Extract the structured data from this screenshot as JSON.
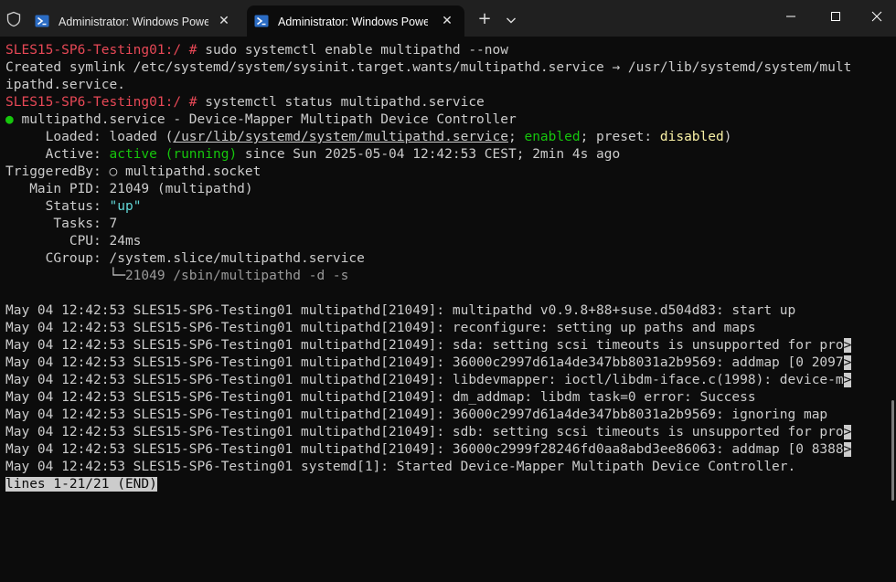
{
  "window": {
    "tabs": [
      {
        "title": "Administrator: Windows PowerShell",
        "close": "✕",
        "icon": "powershell-icon"
      },
      {
        "title": "Administrator: Windows PowerShell",
        "close": "✕",
        "icon": "powershell-icon"
      }
    ],
    "new_tab": "+",
    "controls": {
      "minimize": "minimize-icon",
      "maximize": "maximize-icon",
      "close": "close-icon"
    }
  },
  "colors": {
    "background": "#0c0c0c",
    "prompt": "#e74856",
    "green": "#16c60c",
    "yellow": "#f9f1a5",
    "cyan": "#61d6d6"
  },
  "terminal": {
    "cmd1": {
      "prompt": "SLES15-SP6-Testing01:/ # ",
      "command": "sudo systemctl enable multipathd --now"
    },
    "out1": "Created symlink /etc/systemd/system/sysinit.target.wants/multipathd.service → /usr/lib/systemd/system/mult",
    "out1b": "ipathd.service.",
    "cmd2": {
      "prompt": "SLES15-SP6-Testing01:/ # ",
      "command": "systemctl status multipathd.service"
    },
    "status": {
      "bullet": "●",
      "unit": " multipathd.service - Device-Mapper Multipath Device Controller",
      "loaded_label": "     Loaded: ",
      "loaded_value": "loaded (",
      "loaded_path": "/usr/lib/systemd/system/multipathd.service",
      "loaded_sep": "; ",
      "loaded_enabled": "enabled",
      "loaded_preset": "; preset: ",
      "loaded_disabled": "disabled",
      "loaded_end": ")",
      "active_label": "     Active: ",
      "active_state": "active (running)",
      "active_since": " since Sun 2025-05-04 12:42:53 CEST; 2min 4s ago",
      "triggered": "TriggeredBy: ○ multipathd.socket",
      "main_pid": "   Main PID: 21049 (multipathd)",
      "status_label": "     Status: ",
      "status_value": "\"up\"",
      "tasks": "      Tasks: 7",
      "cpu": "        CPU: 24ms",
      "cgroup": "     CGroup: /system.slice/multipathd.service",
      "cgroup_tree": "             └─",
      "cgroup_proc": "21049 /sbin/multipathd -d -s"
    },
    "log": [
      {
        "text": "May 04 12:42:53 SLES15-SP6-Testing01 multipathd[21049]: multipathd v0.9.8+88+suse.d504d83: start up",
        "truncated": false
      },
      {
        "text": "May 04 12:42:53 SLES15-SP6-Testing01 multipathd[21049]: reconfigure: setting up paths and maps",
        "truncated": false
      },
      {
        "text": "May 04 12:42:53 SLES15-SP6-Testing01 multipathd[21049]: sda: setting scsi timeouts is unsupported for pro",
        "truncated": true
      },
      {
        "text": "May 04 12:42:53 SLES15-SP6-Testing01 multipathd[21049]: 36000c2997d61a4de347bb8031a2b9569: addmap [0 2097",
        "truncated": true
      },
      {
        "text": "May 04 12:42:53 SLES15-SP6-Testing01 multipathd[21049]: libdevmapper: ioctl/libdm-iface.c(1998): device-m",
        "truncated": true
      },
      {
        "text": "May 04 12:42:53 SLES15-SP6-Testing01 multipathd[21049]: dm_addmap: libdm task=0 error: Success",
        "truncated": false
      },
      {
        "text": "May 04 12:42:53 SLES15-SP6-Testing01 multipathd[21049]: 36000c2997d61a4de347bb8031a2b9569: ignoring map",
        "truncated": false
      },
      {
        "text": "May 04 12:42:53 SLES15-SP6-Testing01 multipathd[21049]: sdb: setting scsi timeouts is unsupported for pro",
        "truncated": true
      },
      {
        "text": "May 04 12:42:53 SLES15-SP6-Testing01 multipathd[21049]: 36000c2999f28246fd0aa8abd3ee86063: addmap [0 8388",
        "truncated": true
      },
      {
        "text": "May 04 12:42:53 SLES15-SP6-Testing01 systemd[1]: Started Device-Mapper Multipath Device Controller.",
        "truncated": false
      }
    ],
    "truncation_marker": ">",
    "pager": "lines 1-21/21 (END)"
  }
}
